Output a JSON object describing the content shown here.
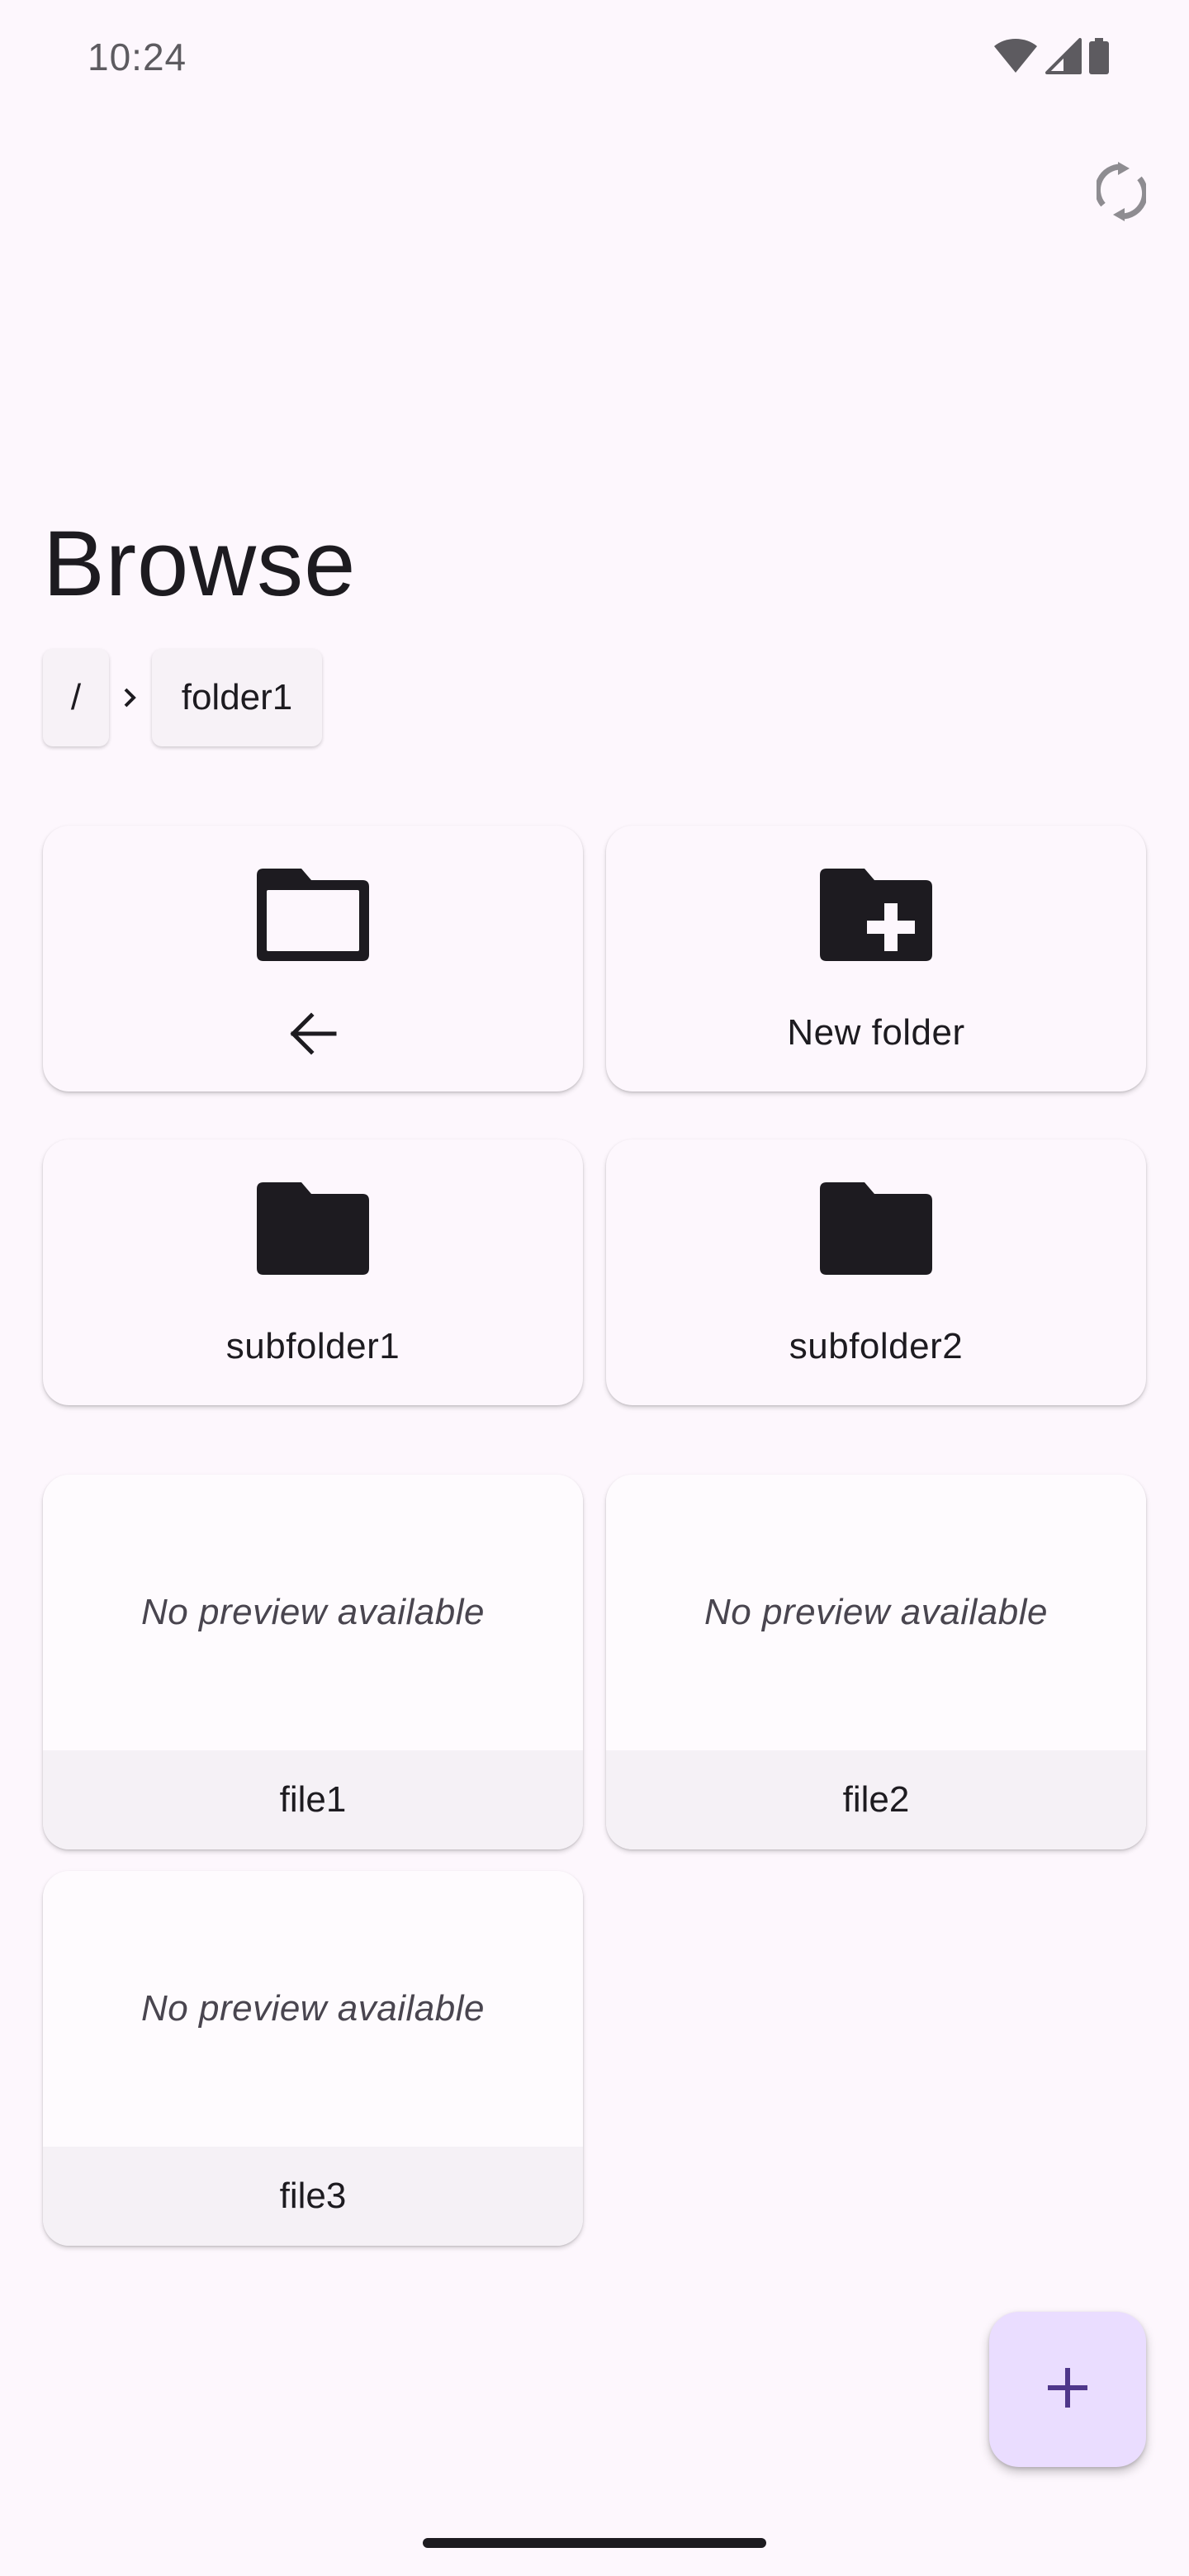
{
  "status_bar": {
    "time": "10:24"
  },
  "header": {
    "title": "Browse",
    "refresh_icon": "sync-icon"
  },
  "breadcrumb": {
    "root": "/",
    "current": "folder1",
    "separator_icon": "chevron-right-icon"
  },
  "folders": {
    "up": {
      "icon": "folder-outline-icon",
      "label_icon": "arrow-left-icon"
    },
    "new_folder": {
      "icon": "create-new-folder-icon",
      "label": "New folder"
    },
    "items": [
      {
        "label": "subfolder1",
        "icon": "folder-icon"
      },
      {
        "label": "subfolder2",
        "icon": "folder-icon"
      }
    ]
  },
  "files": {
    "preview_text": "No preview available",
    "items": [
      {
        "label": "file1"
      },
      {
        "label": "file2"
      },
      {
        "label": "file3"
      }
    ]
  },
  "fab": {
    "icon": "add-icon"
  },
  "colors": {
    "background": "#fdf7fd",
    "fab_background": "#eaddff",
    "fab_icon": "#4f378b",
    "file_footer": "#f5f1f6",
    "icon": "#1d1b20"
  }
}
